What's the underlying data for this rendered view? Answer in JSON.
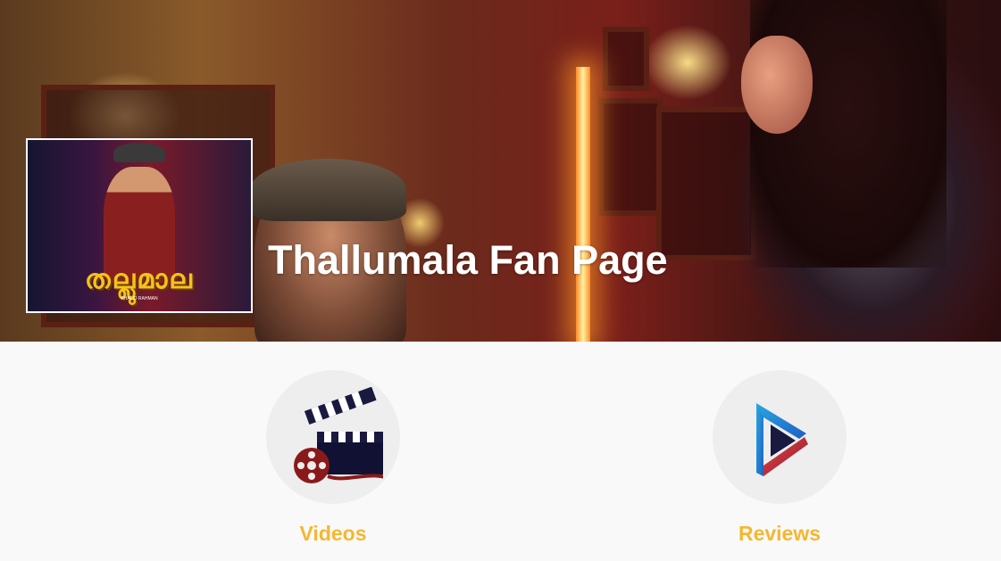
{
  "header": {
    "title": "Thallumala Fan Page",
    "poster_alt": "Thallumala movie poster",
    "poster_title": "തല്ലുമാല",
    "poster_credits": "KHALID RAHMAN"
  },
  "tiles": [
    {
      "label": "Videos",
      "icon": "film-clapperboard-icon"
    },
    {
      "label": "Reviews",
      "icon": "play-icon"
    }
  ],
  "colors": {
    "label": "#f5b731",
    "background": "#f9f9f9",
    "circle": "#eeeeee"
  }
}
